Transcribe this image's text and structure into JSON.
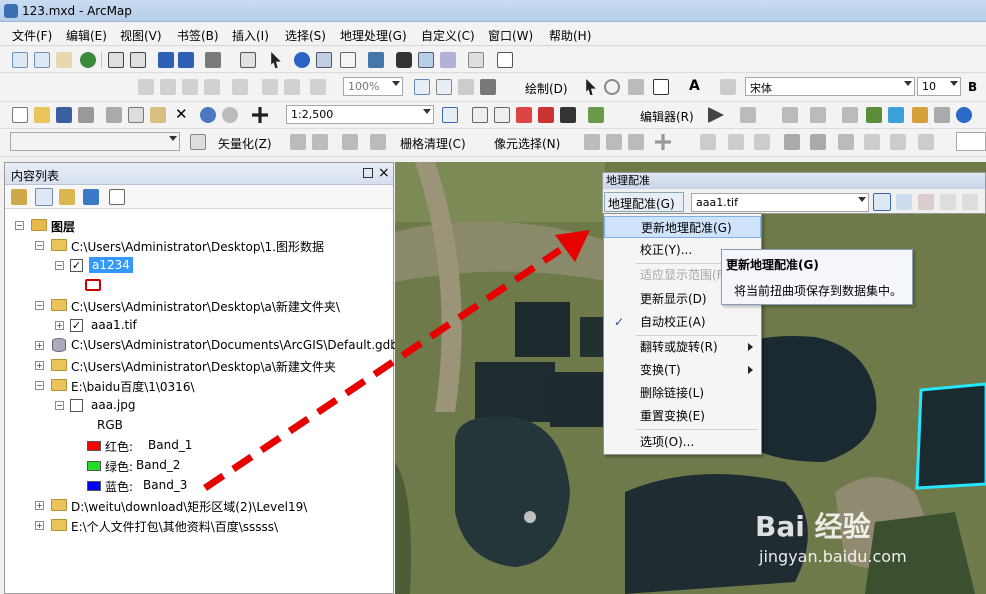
{
  "window": {
    "title": "123.mxd - ArcMap"
  },
  "menubar": [
    "文件(F)",
    "编辑(E)",
    "视图(V)",
    "书签(B)",
    "插入(I)",
    "选择(S)",
    "地理处理(G)",
    "自定义(C)",
    "窗口(W)",
    "帮助(H)"
  ],
  "toolbar2": {
    "zoom": "100%",
    "draw_label": "绘制(D)",
    "font": "宋体",
    "font_size": "10",
    "bold": "B"
  },
  "toolbar3": {
    "scale": "1:2,500",
    "editor_label": "编辑器(R)"
  },
  "toolbar4": {
    "vectorize_label": "矢量化(Z)",
    "raster_clean_label": "栅格清理(C)",
    "pixel_select_label": "像元选择(N)"
  },
  "toc": {
    "title": "内容列表",
    "close": "×",
    "root": "图层",
    "items": [
      "C:\\Users\\Administrator\\Desktop\\1.图形数据",
      "a1234",
      "C:\\Users\\Administrator\\Desktop\\a\\新建文件夹\\",
      "aaa1.tif",
      "C:\\Users\\Administrator\\Documents\\ArcGIS\\Default.gdb",
      "C:\\Users\\Administrator\\Desktop\\a\\新建文件夹",
      "E:\\baidu百度\\1\\0316\\",
      "aaa.jpg",
      "RGB",
      "D:\\weitu\\download\\矩形区域(2)\\Level19\\",
      "E:\\个人文件打包\\其他资料\\百度\\sssss\\"
    ],
    "bands": [
      {
        "label": "红色:",
        "band": "Band_1",
        "color": "#ff0000"
      },
      {
        "label": "绿色:",
        "band": "Band_2",
        "color": "#22dd22"
      },
      {
        "label": "蓝色:",
        "band": "Band_3",
        "color": "#0000ff"
      }
    ]
  },
  "georef": {
    "title": "地理配准",
    "menu_button": "地理配准(G)",
    "layer": "aaa1.tif"
  },
  "context_menu": [
    {
      "label": "更新地理配准(G)",
      "state": "highlighted"
    },
    {
      "label": "校正(Y)..."
    },
    {
      "label": "适应显示范围(F)",
      "state": "disabled"
    },
    {
      "label": "更新显示(D)"
    },
    {
      "label": "自动校正(A)",
      "state": "checked"
    },
    {
      "label": "翻转或旋转(R)",
      "submenu": true
    },
    {
      "label": "变换(T)",
      "submenu": true
    },
    {
      "label": "删除链接(L)"
    },
    {
      "label": "重置变换(E)"
    },
    {
      "label": "选项(O)..."
    }
  ],
  "tooltip": {
    "title": "更新地理配准(G)",
    "body": "将当前扭曲项保存到数据集中。"
  },
  "watermark": {
    "brand": "Bai 经验",
    "url": "jingyan.baidu.com"
  },
  "colors": {
    "annotation_arrow": "#e60000",
    "highlight": "#cfe3fb",
    "selected": "#3399ff"
  }
}
